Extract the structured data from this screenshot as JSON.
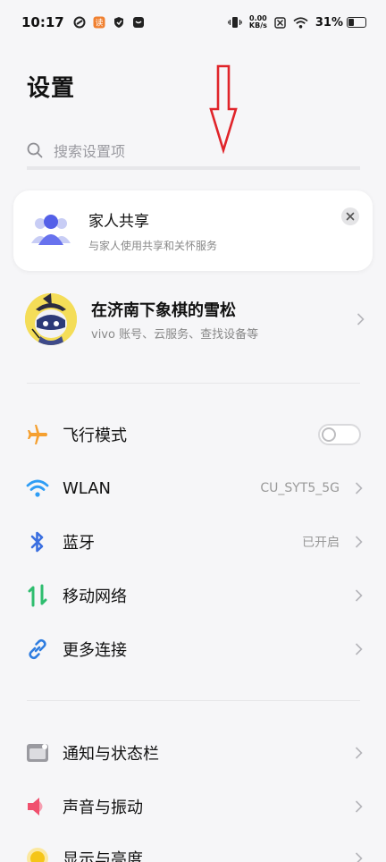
{
  "status_bar": {
    "time": "10:17",
    "net_speed_value": "0.00",
    "net_speed_unit": "KB/s",
    "battery_percent": "31%"
  },
  "page": {
    "title": "设置"
  },
  "search": {
    "placeholder": "搜索设置项"
  },
  "family_card": {
    "title": "家人共享",
    "subtitle": "与家人使用共享和关怀服务"
  },
  "account": {
    "name": "在济南下象棋的雪松",
    "subtitle": "vivo 账号、云服务、查找设备等"
  },
  "connectivity": [
    {
      "label": "飞行模式",
      "value": "",
      "icon": "airplane-icon",
      "color": "#f5a030",
      "toggle_on": false
    },
    {
      "label": "WLAN",
      "value": "CU_SYT5_5G",
      "icon": "wifi-icon",
      "color": "#2f9df5"
    },
    {
      "label": "蓝牙",
      "value": "已开启",
      "icon": "bluetooth-icon",
      "color": "#3b6fe0"
    },
    {
      "label": "移动网络",
      "value": "",
      "icon": "mobile-data-icon",
      "color": "#2fbd6f"
    },
    {
      "label": "更多连接",
      "value": "",
      "icon": "link-icon",
      "color": "#2f7de0"
    }
  ],
  "system": [
    {
      "label": "通知与状态栏",
      "icon": "notification-icon",
      "color": "#9a9aa0"
    },
    {
      "label": "声音与振动",
      "icon": "speaker-icon",
      "color": "#f0506e"
    },
    {
      "label": "显示与亮度",
      "icon": "sun-icon",
      "color": "#f5c518"
    }
  ],
  "accent_colors": {
    "annotation_arrow": "#e0242a"
  }
}
